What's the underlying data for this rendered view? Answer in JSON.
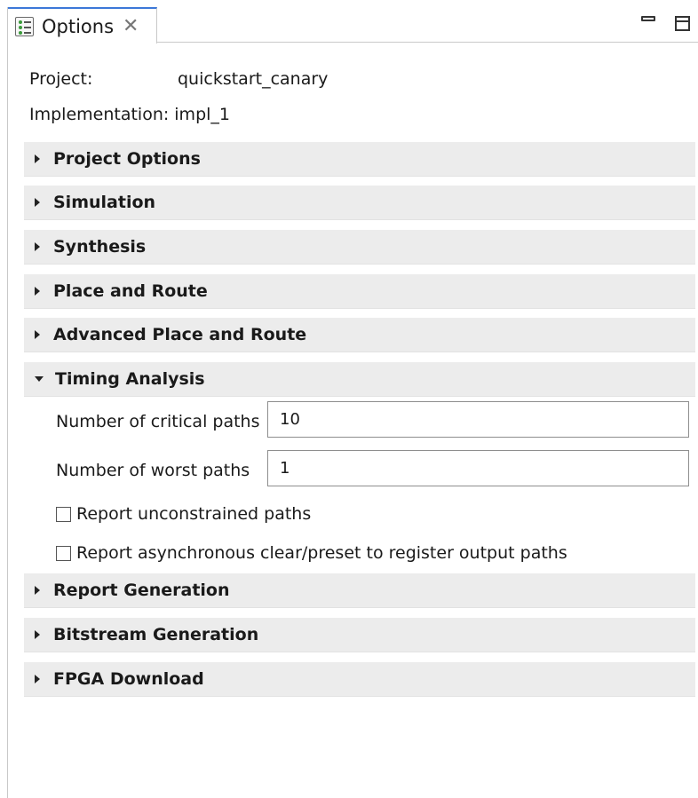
{
  "tab": {
    "label": "Options",
    "close_glyph": "✕",
    "icon": "options-list-icon"
  },
  "window_controls": {
    "minimize_icon": "minimize-icon",
    "maximize_icon": "maximize-icon"
  },
  "project": {
    "label": "Project:",
    "value": "quickstart_canary"
  },
  "implementation": {
    "label": "Implementation:",
    "value": "impl_1"
  },
  "sections": [
    {
      "label": "Project Options",
      "expanded": false
    },
    {
      "label": "Simulation",
      "expanded": false
    },
    {
      "label": "Synthesis",
      "expanded": false
    },
    {
      "label": "Place and Route",
      "expanded": false
    },
    {
      "label": "Advanced Place and Route",
      "expanded": false
    },
    {
      "label": "Timing Analysis",
      "expanded": true
    },
    {
      "label": "Report Generation",
      "expanded": false
    },
    {
      "label": "Bitstream Generation",
      "expanded": false
    },
    {
      "label": "FPGA Download",
      "expanded": false
    }
  ],
  "timing": {
    "critical_paths": {
      "label": "Number of critical paths",
      "value": "10"
    },
    "worst_paths": {
      "label": "Number of worst paths",
      "value": "1"
    },
    "report_unconstrained": {
      "label": "Report unconstrained paths",
      "checked": false
    },
    "report_async": {
      "label": "Report asynchronous clear/preset to register output paths",
      "checked": false
    }
  },
  "colors": {
    "accent": "#3c78d8",
    "section_bg": "#ececec"
  }
}
